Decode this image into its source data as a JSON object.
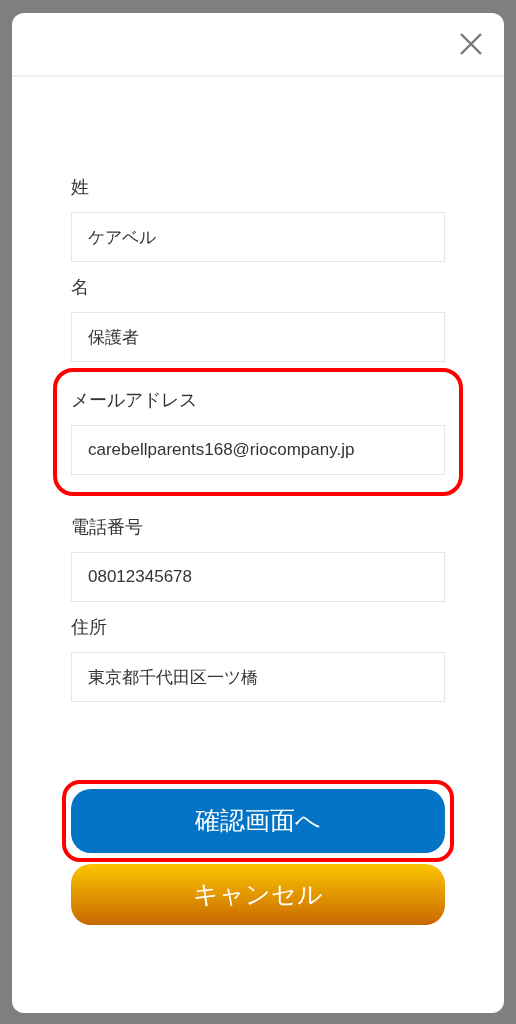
{
  "dialog": {
    "fields": [
      {
        "label": "姓",
        "value": "ケアベル",
        "highlighted": false
      },
      {
        "label": "名",
        "value": "保護者",
        "highlighted": false
      },
      {
        "label": "メールアドレス",
        "value": "carebellparents168@riocompany.jp",
        "highlighted": true
      },
      {
        "label": "電話番号",
        "value": "08012345678",
        "highlighted": false
      },
      {
        "label": "住所",
        "value": "東京都千代田区一ツ橋",
        "highlighted": false
      }
    ],
    "buttons": [
      {
        "kind": "primary",
        "label": "確認画面へ",
        "highlighted": true
      },
      {
        "kind": "cancel",
        "label": "キャンセル",
        "highlighted": false
      }
    ]
  }
}
